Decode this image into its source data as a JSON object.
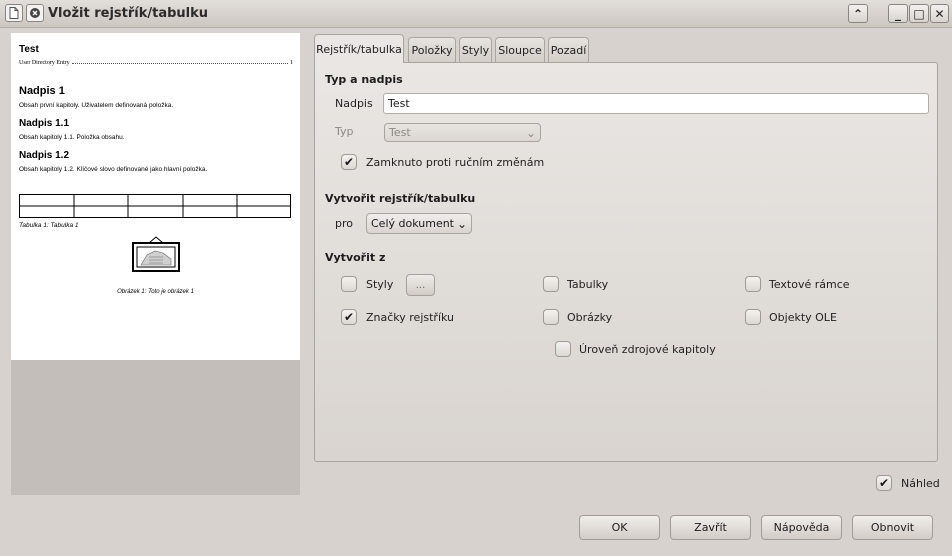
{
  "window": {
    "title": "Vložit rejstřík/tabulku"
  },
  "preview": {
    "heading": "Test",
    "toc_entry": "User Directory Entry",
    "toc_page": "1",
    "h1": "Nadpis 1",
    "p1": "Obsah první kapitoly. Uživatelem definovaná položka.",
    "h11": "Nadpis 1.1",
    "p11": "Obsah kapitoly 1.1. Položka obsahu.",
    "h12": "Nadpis 1.2",
    "p12": "Obsah kapitoly 1.2. Klíčové slovo definované jako hlavní položka.",
    "table_caption": "Tabulka 1: Tabulka 1",
    "image_caption": "Obrázek 1: Toto je obrázek 1"
  },
  "tabs": [
    {
      "label": "Rejstřík/tabulka",
      "active": true
    },
    {
      "label": "Položky"
    },
    {
      "label": "Styly"
    },
    {
      "label": "Sloupce"
    },
    {
      "label": "Pozadí"
    }
  ],
  "type_section": {
    "title": "Typ a nadpis",
    "heading_label": "Nadpis",
    "heading_value": "Test",
    "type_label": "Typ",
    "type_value": "Test",
    "protect_label": "Zamknuto proti ručním změnám",
    "protect_checked": true
  },
  "create_index": {
    "title": "Vytvořit rejstřík/tabulku",
    "for_label": "pro",
    "for_value": "Celý dokument"
  },
  "create_from": {
    "title": "Vytvořit z",
    "styles": {
      "label": "Styly",
      "checked": false
    },
    "styles_button": "...",
    "tables": {
      "label": "Tabulky",
      "checked": false
    },
    "text_frames": {
      "label": "Textové rámce",
      "checked": false
    },
    "index_marks": {
      "label": "Značky rejstříku",
      "checked": true
    },
    "images": {
      "label": "Obrázky",
      "checked": false
    },
    "ole_objects": {
      "label": "Objekty OLE",
      "checked": false
    },
    "chapter_level": {
      "label": "Úroveň zdrojové kapitoly",
      "checked": false
    }
  },
  "preview_toggle": {
    "label": "Náhled",
    "checked": true
  },
  "buttons": {
    "ok": "OK",
    "close": "Zavřít",
    "help": "Nápověda",
    "reset": "Obnovit"
  },
  "icons": {
    "check": "✔",
    "chevron": "⌄"
  }
}
